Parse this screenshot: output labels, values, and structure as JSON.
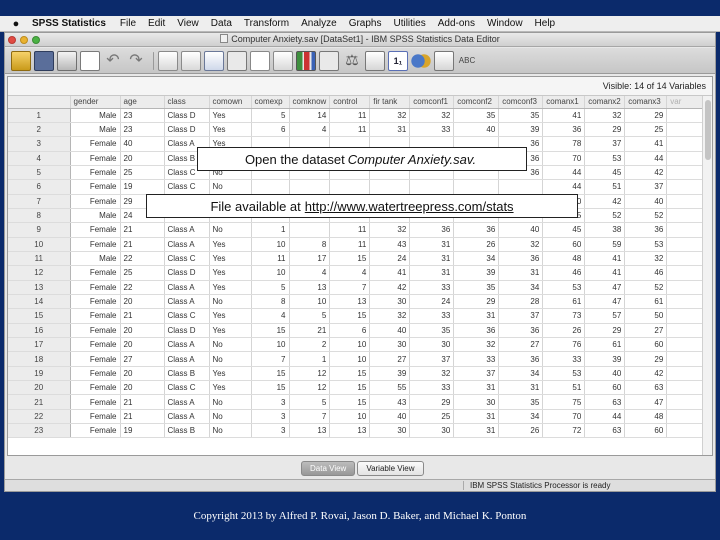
{
  "menubar": {
    "apple_icon": "apple-icon",
    "app_name": "SPSS Statistics",
    "items": [
      "File",
      "Edit",
      "View",
      "Data",
      "Transform",
      "Analyze",
      "Graphs",
      "Utilities",
      "Add-ons",
      "Window",
      "Help"
    ]
  },
  "window": {
    "title": "Computer Anxiety.sav [DataSet1] - IBM SPSS Statistics Data Editor"
  },
  "toolbar": {
    "values_label": "1₁",
    "spell_label": "ABC"
  },
  "grid": {
    "visible_label": "Visible: 14 of 14 Variables",
    "columns": [
      "gender",
      "age",
      "class",
      "comown",
      "comexp",
      "comknow",
      "control",
      "fir tank",
      "comconf1",
      "comconf2",
      "comconf3",
      "comanx1",
      "comanx2",
      "comanx3",
      "var"
    ],
    "rows": [
      [
        "1",
        "Male",
        "23",
        "Class D",
        "Yes",
        "5",
        "14",
        "11",
        "32",
        "32",
        "35",
        "35",
        "41",
        "32",
        "29"
      ],
      [
        "2",
        "Male",
        "23",
        "Class D",
        "Yes",
        "6",
        "4",
        "11",
        "31",
        "33",
        "40",
        "39",
        "36",
        "29",
        "25"
      ],
      [
        "3",
        "Female",
        "40",
        "Class A",
        "Yes",
        "",
        "",
        "",
        "",
        "",
        "",
        "36",
        "78",
        "37",
        "41"
      ],
      [
        "4",
        "Female",
        "20",
        "Class B",
        "Yes",
        "",
        "",
        "",
        "",
        "",
        "",
        "36",
        "70",
        "53",
        "44"
      ],
      [
        "5",
        "Female",
        "25",
        "Class C",
        "No",
        "",
        "",
        "",
        "",
        "",
        "",
        "36",
        "44",
        "45",
        "42"
      ],
      [
        "6",
        "Female",
        "19",
        "Class C",
        "No",
        "",
        "",
        "",
        "",
        "",
        "",
        "",
        "44",
        "51",
        "37"
      ],
      [
        "7",
        "Female",
        "29",
        "Class C",
        "Yes",
        "",
        "",
        "",
        "",
        "",
        "",
        "",
        "40",
        "42",
        "40"
      ],
      [
        "8",
        "Male",
        "24",
        "Class A",
        "Yes",
        "",
        "",
        "",
        "",
        "",
        "",
        "",
        "45",
        "52",
        "52"
      ],
      [
        "9",
        "Female",
        "21",
        "Class A",
        "No",
        "1",
        "",
        "11",
        "32",
        "36",
        "36",
        "40",
        "45",
        "38",
        "36"
      ],
      [
        "10",
        "Female",
        "21",
        "Class A",
        "Yes",
        "10",
        "8",
        "11",
        "43",
        "31",
        "26",
        "32",
        "60",
        "59",
        "53"
      ],
      [
        "11",
        "Male",
        "22",
        "Class C",
        "Yes",
        "11",
        "17",
        "15",
        "24",
        "31",
        "34",
        "36",
        "48",
        "41",
        "32"
      ],
      [
        "12",
        "Female",
        "25",
        "Class D",
        "Yes",
        "10",
        "4",
        "4",
        "41",
        "31",
        "39",
        "31",
        "46",
        "41",
        "46"
      ],
      [
        "13",
        "Female",
        "22",
        "Class A",
        "Yes",
        "5",
        "13",
        "7",
        "42",
        "33",
        "35",
        "34",
        "53",
        "47",
        "52"
      ],
      [
        "14",
        "Female",
        "20",
        "Class A",
        "No",
        "8",
        "10",
        "13",
        "30",
        "24",
        "29",
        "28",
        "61",
        "47",
        "61"
      ],
      [
        "15",
        "Female",
        "21",
        "Class C",
        "Yes",
        "4",
        "5",
        "15",
        "32",
        "33",
        "31",
        "37",
        "73",
        "57",
        "50"
      ],
      [
        "16",
        "Female",
        "20",
        "Class D",
        "Yes",
        "15",
        "21",
        "6",
        "40",
        "35",
        "36",
        "36",
        "26",
        "29",
        "27"
      ],
      [
        "17",
        "Female",
        "20",
        "Class A",
        "No",
        "10",
        "2",
        "10",
        "30",
        "30",
        "32",
        "27",
        "76",
        "61",
        "60"
      ],
      [
        "18",
        "Female",
        "27",
        "Class A",
        "No",
        "7",
        "1",
        "10",
        "27",
        "37",
        "33",
        "36",
        "33",
        "39",
        "29"
      ],
      [
        "19",
        "Female",
        "20",
        "Class B",
        "Yes",
        "15",
        "12",
        "15",
        "39",
        "32",
        "37",
        "34",
        "53",
        "40",
        "42"
      ],
      [
        "20",
        "Female",
        "20",
        "Class C",
        "Yes",
        "15",
        "12",
        "15",
        "55",
        "33",
        "31",
        "31",
        "51",
        "60",
        "63"
      ],
      [
        "21",
        "Female",
        "21",
        "Class A",
        "No",
        "3",
        "5",
        "15",
        "43",
        "29",
        "30",
        "35",
        "75",
        "63",
        "47"
      ],
      [
        "22",
        "Female",
        "21",
        "Class A",
        "No",
        "3",
        "7",
        "10",
        "40",
        "25",
        "31",
        "34",
        "70",
        "44",
        "48"
      ],
      [
        "23",
        "Female",
        "19",
        "Class B",
        "No",
        "3",
        "13",
        "13",
        "30",
        "30",
        "31",
        "26",
        "72",
        "63",
        "60"
      ]
    ]
  },
  "overlay": {
    "line1_prefix": "Open the dataset",
    "line1_em": "Computer Anxiety.sav.",
    "line2_prefix": "File available at",
    "line2_link": "http://www.watertreepress.com/stats"
  },
  "tabs": {
    "data_view": "Data View",
    "variable_view": "Variable View"
  },
  "status": {
    "processor": "IBM SPSS Statistics Processor is ready"
  },
  "footer": {
    "copyright": "Copyright 2013 by Alfred P. Rovai, Jason D. Baker, and Michael K. Ponton"
  }
}
